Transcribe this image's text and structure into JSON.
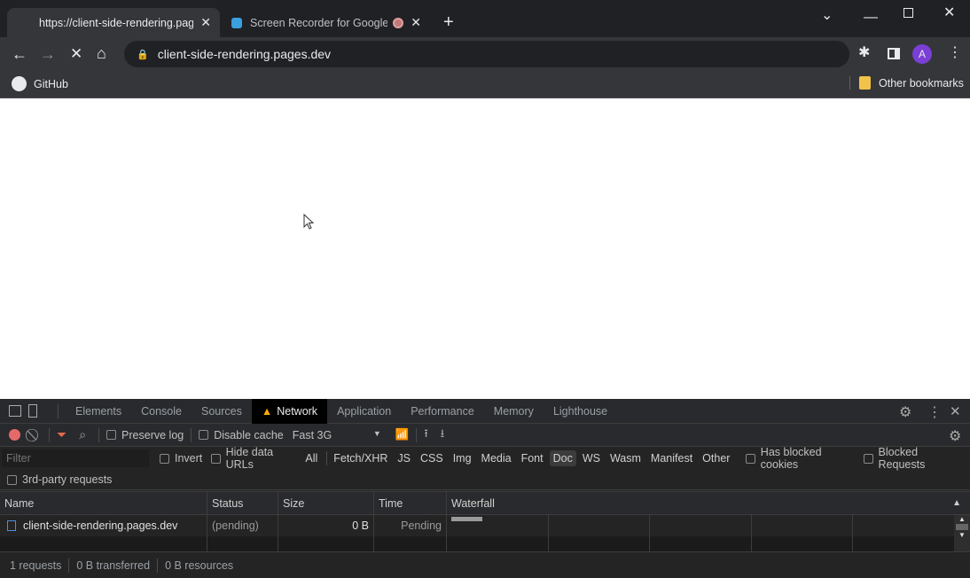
{
  "browser": {
    "tabs": [
      {
        "title": "https://client-side-rendering.pages.dev",
        "active": true
      },
      {
        "title": "Screen Recorder for Google Chrome",
        "active": false,
        "recording": true
      }
    ],
    "address": "client-side-rendering.pages.dev",
    "bookmarks": {
      "github": "GitHub",
      "other": "Other bookmarks"
    },
    "profile_initial": "A",
    "profile_color": "#7b3fd6"
  },
  "devtools": {
    "tabs": [
      "Elements",
      "Console",
      "Sources",
      "Network",
      "Application",
      "Performance",
      "Memory",
      "Lighthouse"
    ],
    "active_tab": "Network",
    "toolbar": {
      "preserve_log": "Preserve log",
      "disable_cache": "Disable cache",
      "throttle": "Fast 3G"
    },
    "filter": {
      "placeholder": "Filter",
      "invert": "Invert",
      "hide_data_urls": "Hide data URLs",
      "types": [
        "All",
        "Fetch/XHR",
        "JS",
        "CSS",
        "Img",
        "Media",
        "Font",
        "Doc",
        "WS",
        "Wasm",
        "Manifest",
        "Other"
      ],
      "selected_type": "Doc",
      "has_blocked_cookies": "Has blocked cookies",
      "blocked_requests": "Blocked Requests",
      "third_party": "3rd-party requests"
    },
    "columns": [
      "Name",
      "Status",
      "Size",
      "Time",
      "Waterfall"
    ],
    "rows": [
      {
        "name": "client-side-rendering.pages.dev",
        "status": "(pending)",
        "size": "0 B",
        "time": "Pending"
      }
    ],
    "summary": {
      "requests": "1 requests",
      "transferred": "0 B transferred",
      "resources": "0 B resources"
    }
  }
}
